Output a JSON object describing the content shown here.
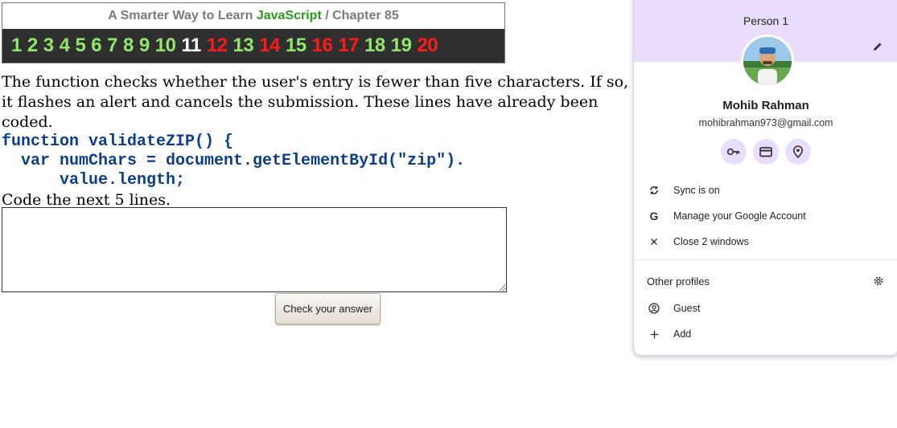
{
  "course": {
    "title_prefix": "A Smarter Way to Learn ",
    "title_brand": "JavaScript",
    "title_sep": " / ",
    "title_chapter": "Chapter 85"
  },
  "exercises": [
    {
      "n": "1",
      "state": "done"
    },
    {
      "n": "2",
      "state": "done"
    },
    {
      "n": "3",
      "state": "done"
    },
    {
      "n": "4",
      "state": "done"
    },
    {
      "n": "5",
      "state": "done"
    },
    {
      "n": "6",
      "state": "done"
    },
    {
      "n": "7",
      "state": "done"
    },
    {
      "n": "8",
      "state": "done"
    },
    {
      "n": "9",
      "state": "done"
    },
    {
      "n": "10",
      "state": "done"
    },
    {
      "n": "11",
      "state": "current"
    },
    {
      "n": "12",
      "state": "todo"
    },
    {
      "n": "13",
      "state": "done"
    },
    {
      "n": "14",
      "state": "todo"
    },
    {
      "n": "15",
      "state": "done"
    },
    {
      "n": "16",
      "state": "todo"
    },
    {
      "n": "17",
      "state": "todo"
    },
    {
      "n": "18",
      "state": "done"
    },
    {
      "n": "19",
      "state": "done"
    },
    {
      "n": "20",
      "state": "todo"
    }
  ],
  "colors": {
    "done": "#90e86a",
    "current": "#ffffff",
    "todo": "#ff1a1a",
    "code": "#0b3d91",
    "brand": "#2a9a1a",
    "panel_header": "#eadcfc"
  },
  "instructions": {
    "text": "The function checks whether the user's entry is fewer than five characters. If so, it flashes an alert and cancels the submission. These lines have already been coded.",
    "code_line1": "function validateZIP() {",
    "code_line2": "  var numChars = document.getElementById(\"zip\").",
    "code_line3": "      value.length;",
    "task": "Code the next 5 lines."
  },
  "answer": {
    "value": "",
    "button_label": "Check your answer"
  },
  "profile": {
    "header_label": "Person 1",
    "name": "Mohib Rahman",
    "email": "mohibrahman973@gmail.com",
    "quick_actions": [
      "key-icon",
      "credit-card-icon",
      "location-pin-icon"
    ],
    "menu": [
      {
        "icon": "sync-icon",
        "label": "Sync is on"
      },
      {
        "icon": "google-g-icon",
        "label": "Manage your Google Account"
      },
      {
        "icon": "close-icon",
        "label": "Close 2 windows"
      }
    ],
    "other_profiles_label": "Other profiles",
    "other_items": [
      {
        "icon": "account-circle-icon",
        "label": "Guest"
      },
      {
        "icon": "plus-icon",
        "label": "Add"
      }
    ]
  }
}
